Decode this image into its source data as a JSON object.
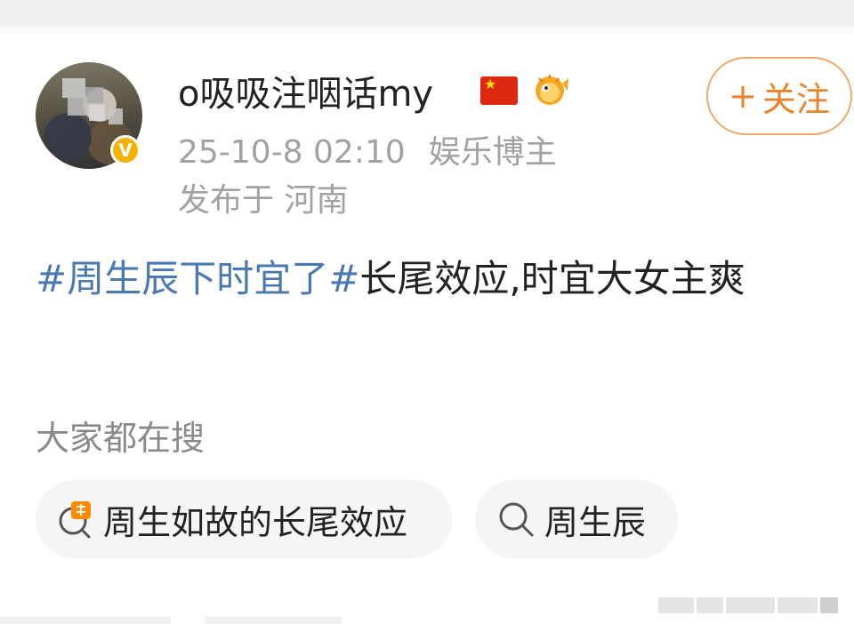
{
  "user": {
    "name": "o吸吸注咽话my",
    "time": "25-10-8 02:10",
    "role": "娱乐博主",
    "location": "发布于 河南",
    "verified_badge": "V"
  },
  "follow_button": {
    "plus": "+",
    "label": "关注"
  },
  "post": {
    "tag": "#周生辰下时宜了#",
    "text": "长尾效应,时宜大女主爽"
  },
  "search": {
    "title": "大家都在搜",
    "chips": [
      {
        "icon": "hot-search-icon",
        "label": "周生如故的长尾效应"
      },
      {
        "icon": "search-icon",
        "label": "周生辰"
      }
    ]
  },
  "colors": {
    "accent_orange": "#e9842c",
    "hashtag_blue": "#4a78b0",
    "muted_gray": "#a2a2a2",
    "verified_gold": "#f5b300"
  },
  "icons": [
    "verified-badge-icon",
    "china-flag-icon",
    "fish-icon",
    "hot-search-icon",
    "search-icon"
  ]
}
